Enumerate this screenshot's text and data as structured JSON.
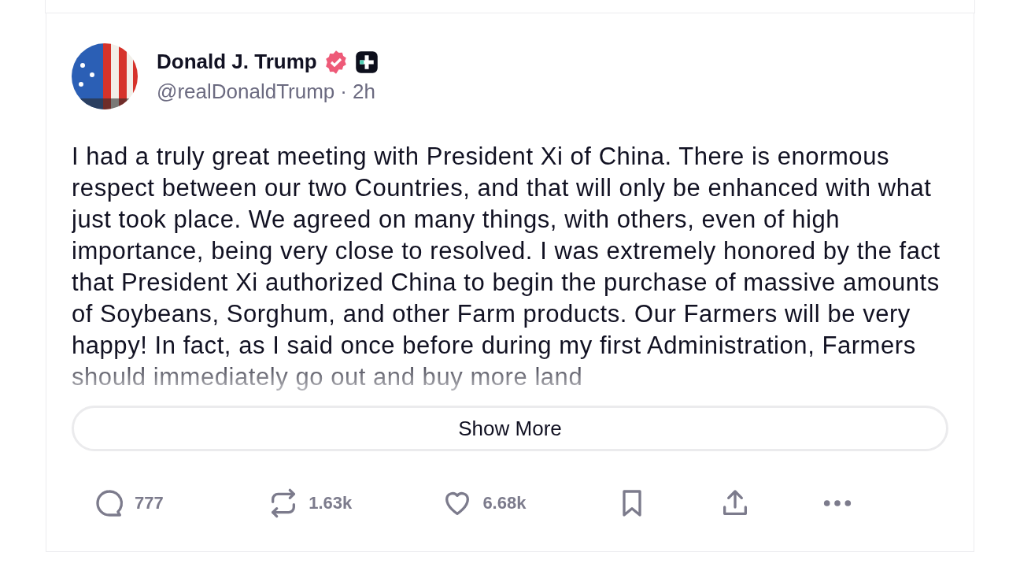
{
  "post": {
    "author": {
      "name": "Donald J. Trump",
      "verified": true,
      "handle": "@realDonaldTrump",
      "separator": "·",
      "time": "2h"
    },
    "text": "I had a truly great meeting with President Xi of China. There is enormous respect between our two Countries, and that will only be enhanced with what just took place. We agreed on many things, with others, even of high importance, being very close to resolved. I was extremely honored by the fact that President Xi authorized China to begin the purchase of massive amounts of Soybeans, Sorghum, and other Farm products. Our Farmers will be very happy! In fact, as I said once before during my first Administration, Farmers should immediately go out and buy more land",
    "show_more": "Show More",
    "actions": [
      {
        "kind": "reply",
        "count": "777"
      },
      {
        "kind": "repost",
        "count": "1.63k"
      },
      {
        "kind": "like",
        "count": "6.68k"
      },
      {
        "kind": "bookmark"
      },
      {
        "kind": "share"
      },
      {
        "kind": "more"
      }
    ]
  }
}
